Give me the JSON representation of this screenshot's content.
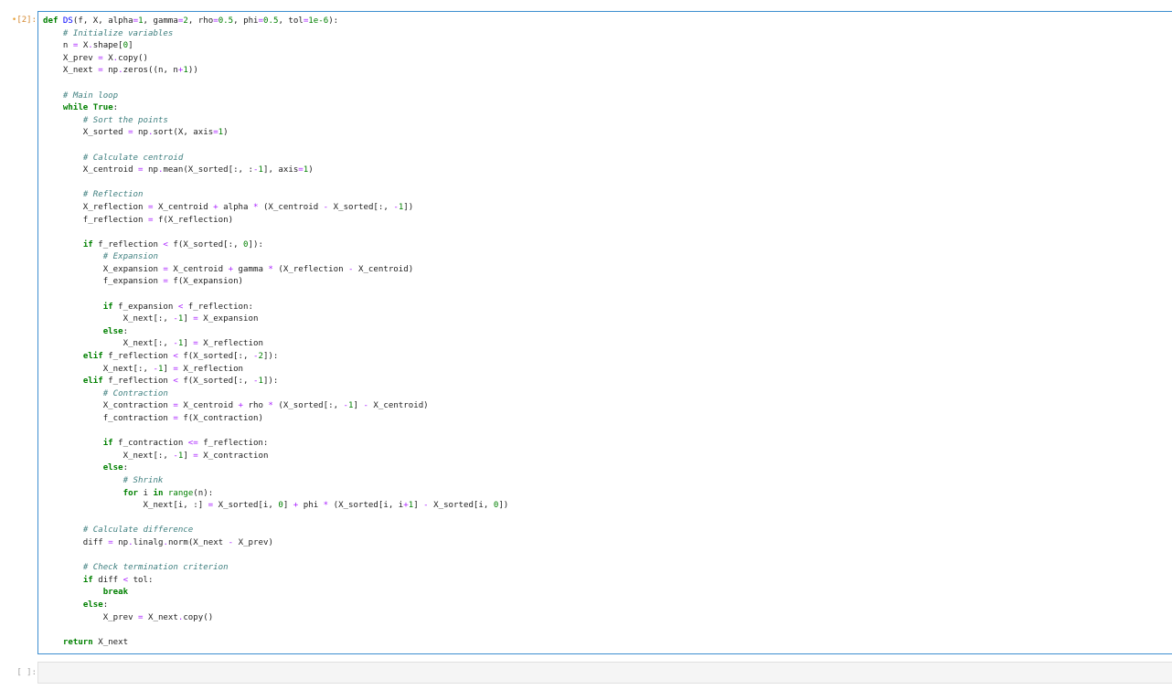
{
  "cells": [
    {
      "prompt_marker": "•",
      "prompt": "[2]:",
      "lines": [
        [
          [
            "kw",
            "def"
          ],
          [
            "txt",
            " "
          ],
          [
            "fn",
            "DS"
          ],
          [
            "txt",
            "(f, X, alpha"
          ],
          [
            "op",
            "="
          ],
          [
            "num",
            "1"
          ],
          [
            "txt",
            ", gamma"
          ],
          [
            "op",
            "="
          ],
          [
            "num",
            "2"
          ],
          [
            "txt",
            ", rho"
          ],
          [
            "op",
            "="
          ],
          [
            "num",
            "0.5"
          ],
          [
            "txt",
            ", phi"
          ],
          [
            "op",
            "="
          ],
          [
            "num",
            "0.5"
          ],
          [
            "txt",
            ", tol"
          ],
          [
            "op",
            "="
          ],
          [
            "num",
            "1e-6"
          ],
          [
            "txt",
            "):"
          ]
        ],
        [
          [
            "txt",
            "    "
          ],
          [
            "com",
            "# Initialize variables"
          ]
        ],
        [
          [
            "txt",
            "    n "
          ],
          [
            "op",
            "="
          ],
          [
            "txt",
            " X"
          ],
          [
            "op",
            "."
          ],
          [
            "txt",
            "shape["
          ],
          [
            "num",
            "0"
          ],
          [
            "txt",
            "]"
          ]
        ],
        [
          [
            "txt",
            "    X_prev "
          ],
          [
            "op",
            "="
          ],
          [
            "txt",
            " X"
          ],
          [
            "op",
            "."
          ],
          [
            "txt",
            "copy()"
          ]
        ],
        [
          [
            "txt",
            "    X_next "
          ],
          [
            "op",
            "="
          ],
          [
            "txt",
            " np"
          ],
          [
            "op",
            "."
          ],
          [
            "txt",
            "zeros((n, n"
          ],
          [
            "op",
            "+"
          ],
          [
            "num",
            "1"
          ],
          [
            "txt",
            "))"
          ]
        ],
        [
          [
            "txt",
            ""
          ]
        ],
        [
          [
            "txt",
            "    "
          ],
          [
            "com",
            "# Main loop"
          ]
        ],
        [
          [
            "txt",
            "    "
          ],
          [
            "kw",
            "while"
          ],
          [
            "txt",
            " "
          ],
          [
            "kw",
            "True"
          ],
          [
            "txt",
            ":"
          ]
        ],
        [
          [
            "txt",
            "        "
          ],
          [
            "com",
            "# Sort the points"
          ]
        ],
        [
          [
            "txt",
            "        X_sorted "
          ],
          [
            "op",
            "="
          ],
          [
            "txt",
            " np"
          ],
          [
            "op",
            "."
          ],
          [
            "txt",
            "sort(X, axis"
          ],
          [
            "op",
            "="
          ],
          [
            "num",
            "1"
          ],
          [
            "txt",
            ")"
          ]
        ],
        [
          [
            "txt",
            ""
          ]
        ],
        [
          [
            "txt",
            "        "
          ],
          [
            "com",
            "# Calculate centroid"
          ]
        ],
        [
          [
            "txt",
            "        X_centroid "
          ],
          [
            "op",
            "="
          ],
          [
            "txt",
            " np"
          ],
          [
            "op",
            "."
          ],
          [
            "txt",
            "mean(X_sorted[:, :"
          ],
          [
            "op",
            "-"
          ],
          [
            "num",
            "1"
          ],
          [
            "txt",
            "], axis"
          ],
          [
            "op",
            "="
          ],
          [
            "num",
            "1"
          ],
          [
            "txt",
            ")"
          ]
        ],
        [
          [
            "txt",
            ""
          ]
        ],
        [
          [
            "txt",
            "        "
          ],
          [
            "com",
            "# Reflection"
          ]
        ],
        [
          [
            "txt",
            "        X_reflection "
          ],
          [
            "op",
            "="
          ],
          [
            "txt",
            " X_centroid "
          ],
          [
            "op",
            "+"
          ],
          [
            "txt",
            " alpha "
          ],
          [
            "op",
            "*"
          ],
          [
            "txt",
            " (X_centroid "
          ],
          [
            "op",
            "-"
          ],
          [
            "txt",
            " X_sorted[:, "
          ],
          [
            "op",
            "-"
          ],
          [
            "num",
            "1"
          ],
          [
            "txt",
            "])"
          ]
        ],
        [
          [
            "txt",
            "        f_reflection "
          ],
          [
            "op",
            "="
          ],
          [
            "txt",
            " f(X_reflection)"
          ]
        ],
        [
          [
            "txt",
            ""
          ]
        ],
        [
          [
            "txt",
            "        "
          ],
          [
            "kw",
            "if"
          ],
          [
            "txt",
            " f_reflection "
          ],
          [
            "op",
            "<"
          ],
          [
            "txt",
            " f(X_sorted[:, "
          ],
          [
            "num",
            "0"
          ],
          [
            "txt",
            "]):"
          ]
        ],
        [
          [
            "txt",
            "            "
          ],
          [
            "com",
            "# Expansion"
          ]
        ],
        [
          [
            "txt",
            "            X_expansion "
          ],
          [
            "op",
            "="
          ],
          [
            "txt",
            " X_centroid "
          ],
          [
            "op",
            "+"
          ],
          [
            "txt",
            " gamma "
          ],
          [
            "op",
            "*"
          ],
          [
            "txt",
            " (X_reflection "
          ],
          [
            "op",
            "-"
          ],
          [
            "txt",
            " X_centroid)"
          ]
        ],
        [
          [
            "txt",
            "            f_expansion "
          ],
          [
            "op",
            "="
          ],
          [
            "txt",
            " f(X_expansion)"
          ]
        ],
        [
          [
            "txt",
            ""
          ]
        ],
        [
          [
            "txt",
            "            "
          ],
          [
            "kw",
            "if"
          ],
          [
            "txt",
            " f_expansion "
          ],
          [
            "op",
            "<"
          ],
          [
            "txt",
            " f_reflection:"
          ]
        ],
        [
          [
            "txt",
            "                X_next[:, "
          ],
          [
            "op",
            "-"
          ],
          [
            "num",
            "1"
          ],
          [
            "txt",
            "] "
          ],
          [
            "op",
            "="
          ],
          [
            "txt",
            " X_expansion"
          ]
        ],
        [
          [
            "txt",
            "            "
          ],
          [
            "kw",
            "else"
          ],
          [
            "txt",
            ":"
          ]
        ],
        [
          [
            "txt",
            "                X_next[:, "
          ],
          [
            "op",
            "-"
          ],
          [
            "num",
            "1"
          ],
          [
            "txt",
            "] "
          ],
          [
            "op",
            "="
          ],
          [
            "txt",
            " X_reflection"
          ]
        ],
        [
          [
            "txt",
            "        "
          ],
          [
            "kw",
            "elif"
          ],
          [
            "txt",
            " f_reflection "
          ],
          [
            "op",
            "<"
          ],
          [
            "txt",
            " f(X_sorted[:, "
          ],
          [
            "op",
            "-"
          ],
          [
            "num",
            "2"
          ],
          [
            "txt",
            "]):"
          ]
        ],
        [
          [
            "txt",
            "            X_next[:, "
          ],
          [
            "op",
            "-"
          ],
          [
            "num",
            "1"
          ],
          [
            "txt",
            "] "
          ],
          [
            "op",
            "="
          ],
          [
            "txt",
            " X_reflection"
          ]
        ],
        [
          [
            "txt",
            "        "
          ],
          [
            "kw",
            "elif"
          ],
          [
            "txt",
            " f_reflection "
          ],
          [
            "op",
            "<"
          ],
          [
            "txt",
            " f(X_sorted[:, "
          ],
          [
            "op",
            "-"
          ],
          [
            "num",
            "1"
          ],
          [
            "txt",
            "]):"
          ]
        ],
        [
          [
            "txt",
            "            "
          ],
          [
            "com",
            "# Contraction"
          ]
        ],
        [
          [
            "txt",
            "            X_contraction "
          ],
          [
            "op",
            "="
          ],
          [
            "txt",
            " X_centroid "
          ],
          [
            "op",
            "+"
          ],
          [
            "txt",
            " rho "
          ],
          [
            "op",
            "*"
          ],
          [
            "txt",
            " (X_sorted[:, "
          ],
          [
            "op",
            "-"
          ],
          [
            "num",
            "1"
          ],
          [
            "txt",
            "] "
          ],
          [
            "op",
            "-"
          ],
          [
            "txt",
            " X_centroid)"
          ]
        ],
        [
          [
            "txt",
            "            f_contraction "
          ],
          [
            "op",
            "="
          ],
          [
            "txt",
            " f(X_contraction)"
          ]
        ],
        [
          [
            "txt",
            ""
          ]
        ],
        [
          [
            "txt",
            "            "
          ],
          [
            "kw",
            "if"
          ],
          [
            "txt",
            " f_contraction "
          ],
          [
            "op",
            "<="
          ],
          [
            "txt",
            " f_reflection:"
          ]
        ],
        [
          [
            "txt",
            "                X_next[:, "
          ],
          [
            "op",
            "-"
          ],
          [
            "num",
            "1"
          ],
          [
            "txt",
            "] "
          ],
          [
            "op",
            "="
          ],
          [
            "txt",
            " X_contraction"
          ]
        ],
        [
          [
            "txt",
            "            "
          ],
          [
            "kw",
            "else"
          ],
          [
            "txt",
            ":"
          ]
        ],
        [
          [
            "txt",
            "                "
          ],
          [
            "com",
            "# Shrink"
          ]
        ],
        [
          [
            "txt",
            "                "
          ],
          [
            "kw",
            "for"
          ],
          [
            "txt",
            " i "
          ],
          [
            "kw",
            "in"
          ],
          [
            "txt",
            " "
          ],
          [
            "bi",
            "range"
          ],
          [
            "txt",
            "(n):"
          ]
        ],
        [
          [
            "txt",
            "                    X_next[i, :] "
          ],
          [
            "op",
            "="
          ],
          [
            "txt",
            " X_sorted[i, "
          ],
          [
            "num",
            "0"
          ],
          [
            "txt",
            "] "
          ],
          [
            "op",
            "+"
          ],
          [
            "txt",
            " phi "
          ],
          [
            "op",
            "*"
          ],
          [
            "txt",
            " (X_sorted[i, i"
          ],
          [
            "op",
            "+"
          ],
          [
            "num",
            "1"
          ],
          [
            "txt",
            "] "
          ],
          [
            "op",
            "-"
          ],
          [
            "txt",
            " X_sorted[i, "
          ],
          [
            "num",
            "0"
          ],
          [
            "txt",
            "])"
          ]
        ],
        [
          [
            "txt",
            ""
          ]
        ],
        [
          [
            "txt",
            "        "
          ],
          [
            "com",
            "# Calculate difference"
          ]
        ],
        [
          [
            "txt",
            "        diff "
          ],
          [
            "op",
            "="
          ],
          [
            "txt",
            " np"
          ],
          [
            "op",
            "."
          ],
          [
            "txt",
            "linalg"
          ],
          [
            "op",
            "."
          ],
          [
            "txt",
            "norm(X_next "
          ],
          [
            "op",
            "-"
          ],
          [
            "txt",
            " X_prev)"
          ]
        ],
        [
          [
            "txt",
            ""
          ]
        ],
        [
          [
            "txt",
            "        "
          ],
          [
            "com",
            "# Check termination criterion"
          ]
        ],
        [
          [
            "txt",
            "        "
          ],
          [
            "kw",
            "if"
          ],
          [
            "txt",
            " diff "
          ],
          [
            "op",
            "<"
          ],
          [
            "txt",
            " tol:"
          ]
        ],
        [
          [
            "txt",
            "            "
          ],
          [
            "kw",
            "break"
          ]
        ],
        [
          [
            "txt",
            "        "
          ],
          [
            "kw",
            "else"
          ],
          [
            "txt",
            ":"
          ]
        ],
        [
          [
            "txt",
            "            X_prev "
          ],
          [
            "op",
            "="
          ],
          [
            "txt",
            " X_next"
          ],
          [
            "op",
            "."
          ],
          [
            "txt",
            "copy()"
          ]
        ],
        [
          [
            "txt",
            ""
          ]
        ],
        [
          [
            "txt",
            "    "
          ],
          [
            "kw",
            "return"
          ],
          [
            "txt",
            " X_next"
          ]
        ]
      ]
    },
    {
      "prompt_marker": "",
      "prompt": "[ ]:",
      "lines": []
    }
  ]
}
